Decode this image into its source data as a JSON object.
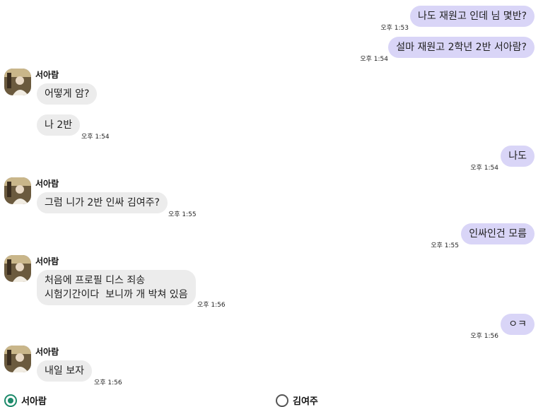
{
  "messages": [
    {
      "text": "나도 재원고 인데 님 몇반?",
      "time": "오후 1:53"
    },
    {
      "text": "설마 재원고 2학년 2반 서아람?",
      "time": "오후 1:54"
    },
    {
      "sender": "서아람",
      "text": "어떻게 암?"
    },
    {
      "text": "나 2반",
      "time": "오후 1:54"
    },
    {
      "text": "나도",
      "time": "오후 1:54"
    },
    {
      "sender": "서아람",
      "text": "그럼 니가 2반 인싸 김여주?",
      "time": "오후 1:55"
    },
    {
      "text": "인싸인건 모름",
      "time": "오후 1:55"
    },
    {
      "sender": "서아람",
      "text": "처음에 프로필 디스 죄송\n시험기간이다  보니까 개 박쳐 있음",
      "time": "오후 1:56"
    },
    {
      "text": "ㅇㅋ",
      "time": "오후 1:56"
    },
    {
      "sender": "서아람",
      "text": "내일 보자",
      "time": "오후 1:56"
    }
  ],
  "participants": {
    "selected": "서아람",
    "other": "김여주"
  },
  "colors": {
    "sent_bubble": "#d9d5f7",
    "received_bubble": "#ececec",
    "radio_accent": "#1d8a6a"
  }
}
